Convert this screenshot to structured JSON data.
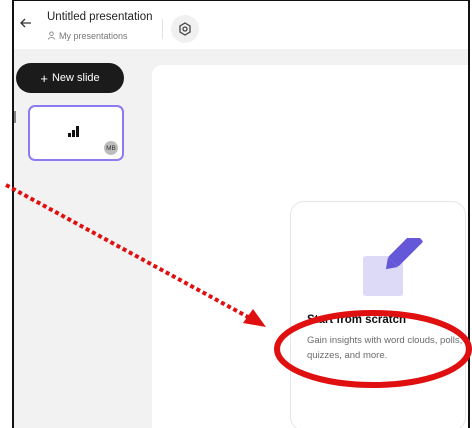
{
  "header": {
    "title": "Untitled presentation",
    "subtitle": "My presentations"
  },
  "sidebar": {
    "new_slide_label": "New slide",
    "thumbnail_avatar": "MB"
  },
  "card": {
    "title": "Start from scratch",
    "description": "Gain insights with word clouds, polls, quizzes, and more."
  },
  "colors": {
    "annotation": "#e01010",
    "thumbnail_border": "#8c7cf2",
    "button_bg": "#1b1b1b",
    "pencil": "#6458d9",
    "square": "#dcdaf7"
  },
  "icons": [
    "back-arrow-icon",
    "person-icon",
    "settings-icon",
    "plus-icon",
    "bar-chart-icon",
    "pencil-icon"
  ]
}
